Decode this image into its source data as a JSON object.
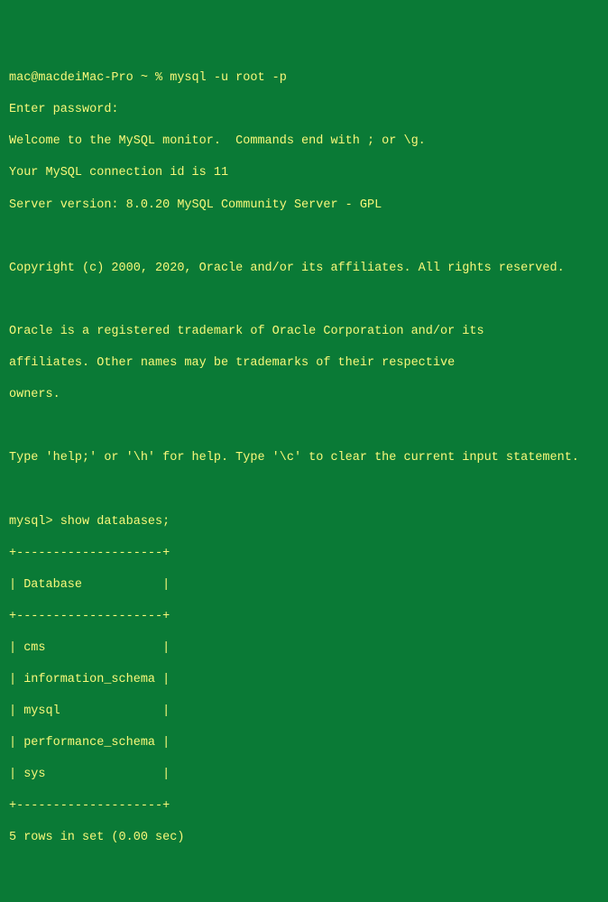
{
  "terminal": {
    "prompt_line": "mac@macdeiMac-Pro ~ % mysql -u root -p",
    "enter_password": "Enter password:",
    "welcome": "Welcome to the MySQL monitor.  Commands end with ; or \\g.",
    "connection_id": "Your MySQL connection id is 11",
    "server_version": "Server version: 8.0.20 MySQL Community Server - GPL",
    "copyright": "Copyright (c) 2000, 2020, Oracle and/or its affiliates. All rights reserved.",
    "trademark_1": "Oracle is a registered trademark of Oracle Corporation and/or its",
    "trademark_2": "affiliates. Other names may be trademarks of their respective",
    "trademark_3": "owners.",
    "help_hint": "Type 'help;' or '\\h' for help. Type '\\c' to clear the current input statement.",
    "mysql_prompt": "mysql> show databases;",
    "border": "+--------------------+",
    "header_row": "| Database           |",
    "rows": [
      "| cms                |",
      "| information_schema |",
      "| mysql              |",
      "| performance_schema |",
      "| sys                |"
    ],
    "summary": "5 rows in set (0.00 sec)"
  }
}
